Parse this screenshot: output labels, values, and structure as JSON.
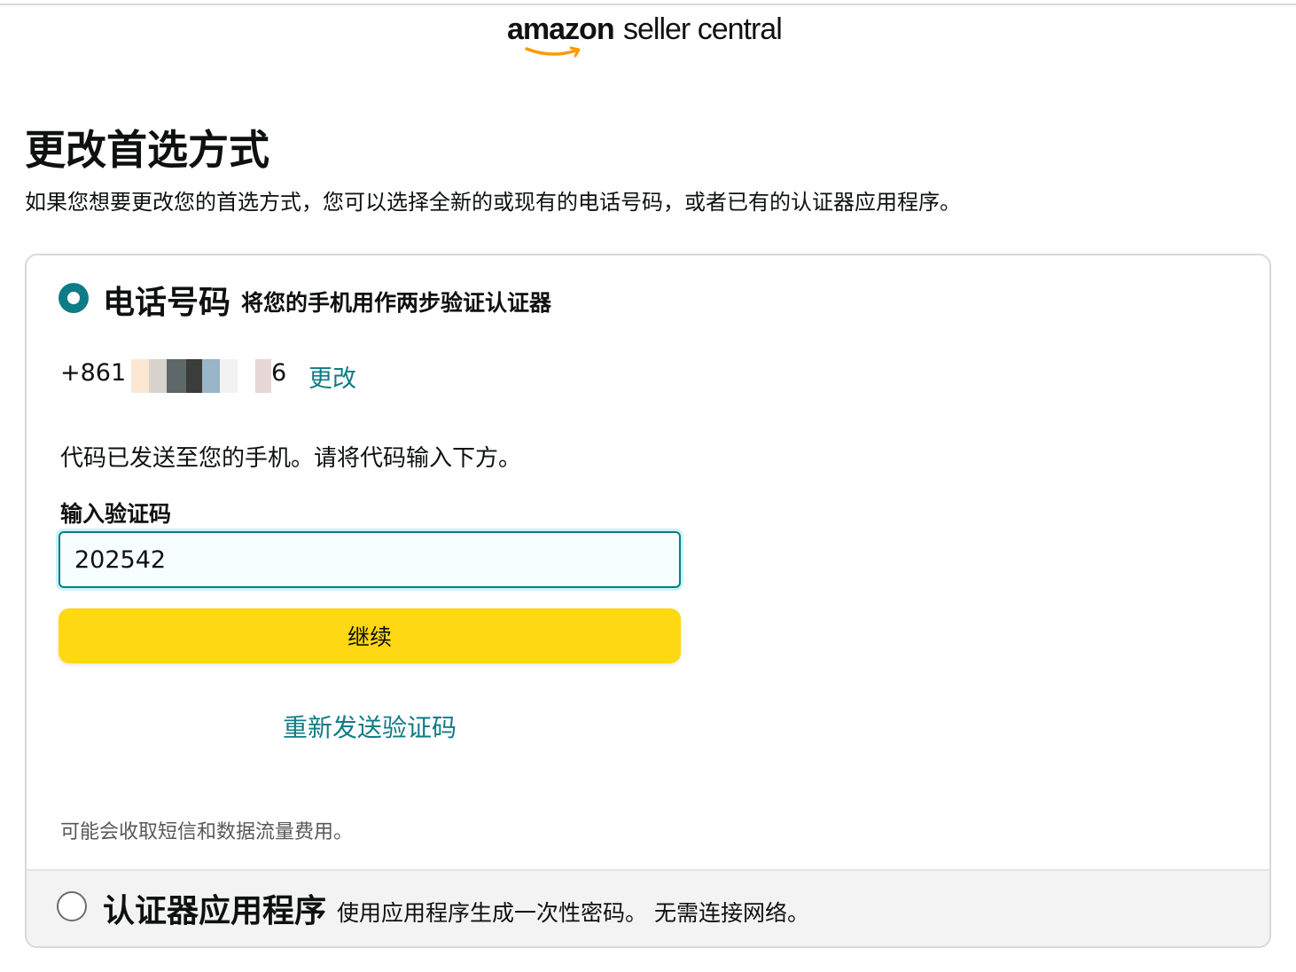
{
  "header": {
    "logo_amazon": "amazon",
    "logo_seller": "seller central"
  },
  "page": {
    "title": "更改首选方式",
    "description": "如果您想要更改您的首选方式，您可以选择全新的或现有的电话号码，或者已有的认证器应用程序。"
  },
  "options": {
    "phone": {
      "title": "电话号码",
      "subtitle": "将您的手机用作两步验证认证器",
      "selected": true,
      "phone_prefix": "+861",
      "phone_suffix": "6",
      "change_label": "更改",
      "code_sent_text": "代码已发送至您的手机。请将代码输入下方。",
      "code_label": "输入验证码",
      "code_value": "202542",
      "continue_label": "继续",
      "resend_label": "重新发送验证码",
      "fee_note": "可能会收取短信和数据流量费用。"
    },
    "authenticator": {
      "title": "认证器应用程序",
      "subtitle": "使用应用程序生成一次性密码。 无需连接网络。",
      "selected": false
    }
  },
  "colors": {
    "accent": "#0e7c86",
    "button": "#ffd814",
    "logo_smile": "#ff9900",
    "muted_text": "#565959",
    "alt_option_bg": "#f3f3f3"
  }
}
